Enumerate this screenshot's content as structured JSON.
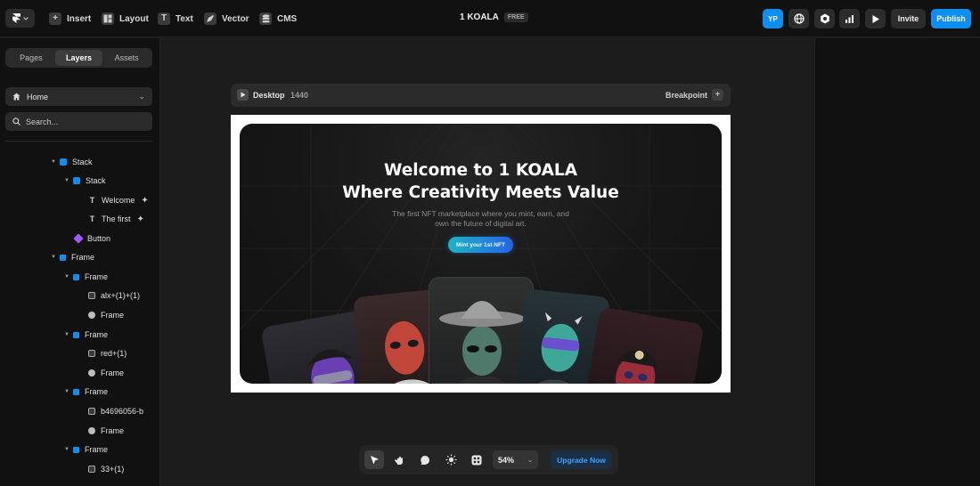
{
  "topbar": {
    "tools": [
      {
        "label": "Insert",
        "icon": "plus-icon"
      },
      {
        "label": "Layout",
        "icon": "layout-icon"
      },
      {
        "label": "Text",
        "icon": "text-icon"
      },
      {
        "label": "Vector",
        "icon": "pen-icon"
      },
      {
        "label": "CMS",
        "icon": "database-icon"
      }
    ],
    "project_name": "1 KOALA",
    "plan_badge": "FREE",
    "avatar_initials": "YP",
    "invite_label": "Invite",
    "publish_label": "Publish"
  },
  "left_panel": {
    "tabs": [
      {
        "label": "Pages",
        "active": false
      },
      {
        "label": "Layers",
        "active": true
      },
      {
        "label": "Assets",
        "active": false
      }
    ],
    "page_selector": "Home",
    "search_placeholder": "Search...",
    "layers": [
      {
        "label": "Stack",
        "type": "stack"
      },
      {
        "label": "Stack",
        "type": "stack"
      },
      {
        "label": "Welcome",
        "type": "text"
      },
      {
        "label": "The first",
        "type": "text"
      },
      {
        "label": "Button",
        "type": "component"
      },
      {
        "label": "Frame",
        "type": "frame"
      },
      {
        "label": "Frame",
        "type": "frame"
      },
      {
        "label": "alx+(1)+(1)",
        "type": "image"
      },
      {
        "label": "Frame",
        "type": "ellipse"
      },
      {
        "label": "Frame",
        "type": "frame"
      },
      {
        "label": "red+(1)",
        "type": "image"
      },
      {
        "label": "Frame",
        "type": "ellipse"
      },
      {
        "label": "Frame",
        "type": "frame"
      },
      {
        "label": "b4696056-b",
        "type": "image"
      },
      {
        "label": "Frame",
        "type": "ellipse"
      },
      {
        "label": "Frame",
        "type": "frame"
      },
      {
        "label": "33+(1)",
        "type": "image"
      }
    ]
  },
  "breakpoint_bar": {
    "device": "Desktop",
    "width": "1440",
    "breakpoint_label": "Breakpoint"
  },
  "hero": {
    "title_line1": "Welcome to 1 KOALA",
    "title_line2": "Where Creativity Meets Value",
    "subtitle_line1": "The first NFT marketplace where you mint, earn, and",
    "subtitle_line2": "own the future of digital art.",
    "cta_label": "Mint your 1st NFT"
  },
  "bottom_toolbar": {
    "zoom": "54%",
    "upgrade_label": "Upgrade Now"
  },
  "colors": {
    "accent_blue": "#0e8ff0",
    "cta_gradient_start": "#1fb4c4",
    "cta_gradient_end": "#2463e8",
    "upgrade_text": "#3fa4ff"
  }
}
